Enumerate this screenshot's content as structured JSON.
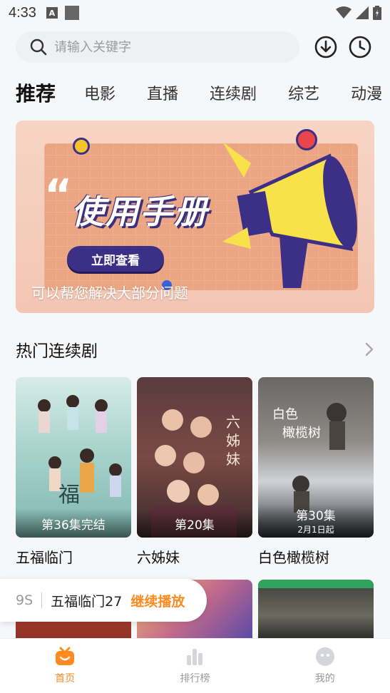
{
  "status_bar": {
    "time": "4:33",
    "badge": "A"
  },
  "search": {
    "placeholder": "请输入关键字"
  },
  "tabs": [
    "推荐",
    "电影",
    "直播",
    "连续剧",
    "综艺",
    "动漫"
  ],
  "banner": {
    "title": "使用手册",
    "button": "立即查看",
    "subtitle": "可以帮您解决大部分问题"
  },
  "section": {
    "title": "热门连续剧"
  },
  "cards": [
    {
      "title": "五福临门",
      "badge": "第36集完结"
    },
    {
      "title": "六姊妹",
      "badge": "第20集"
    },
    {
      "title": "白色橄榄树",
      "badge": "第30集",
      "sub_badge": "2月1日起"
    }
  ],
  "continue_watching": {
    "prefix": "9S",
    "title": "五福临门27",
    "action": "继续播放"
  },
  "bottom_nav": [
    {
      "label": "首页",
      "icon": "home-icon"
    },
    {
      "label": "排行榜",
      "icon": "chart-icon"
    },
    {
      "label": "我的",
      "icon": "profile-icon"
    }
  ],
  "colors": {
    "accent": "#ff8a1f",
    "banner_btn": "#3c2f86"
  }
}
